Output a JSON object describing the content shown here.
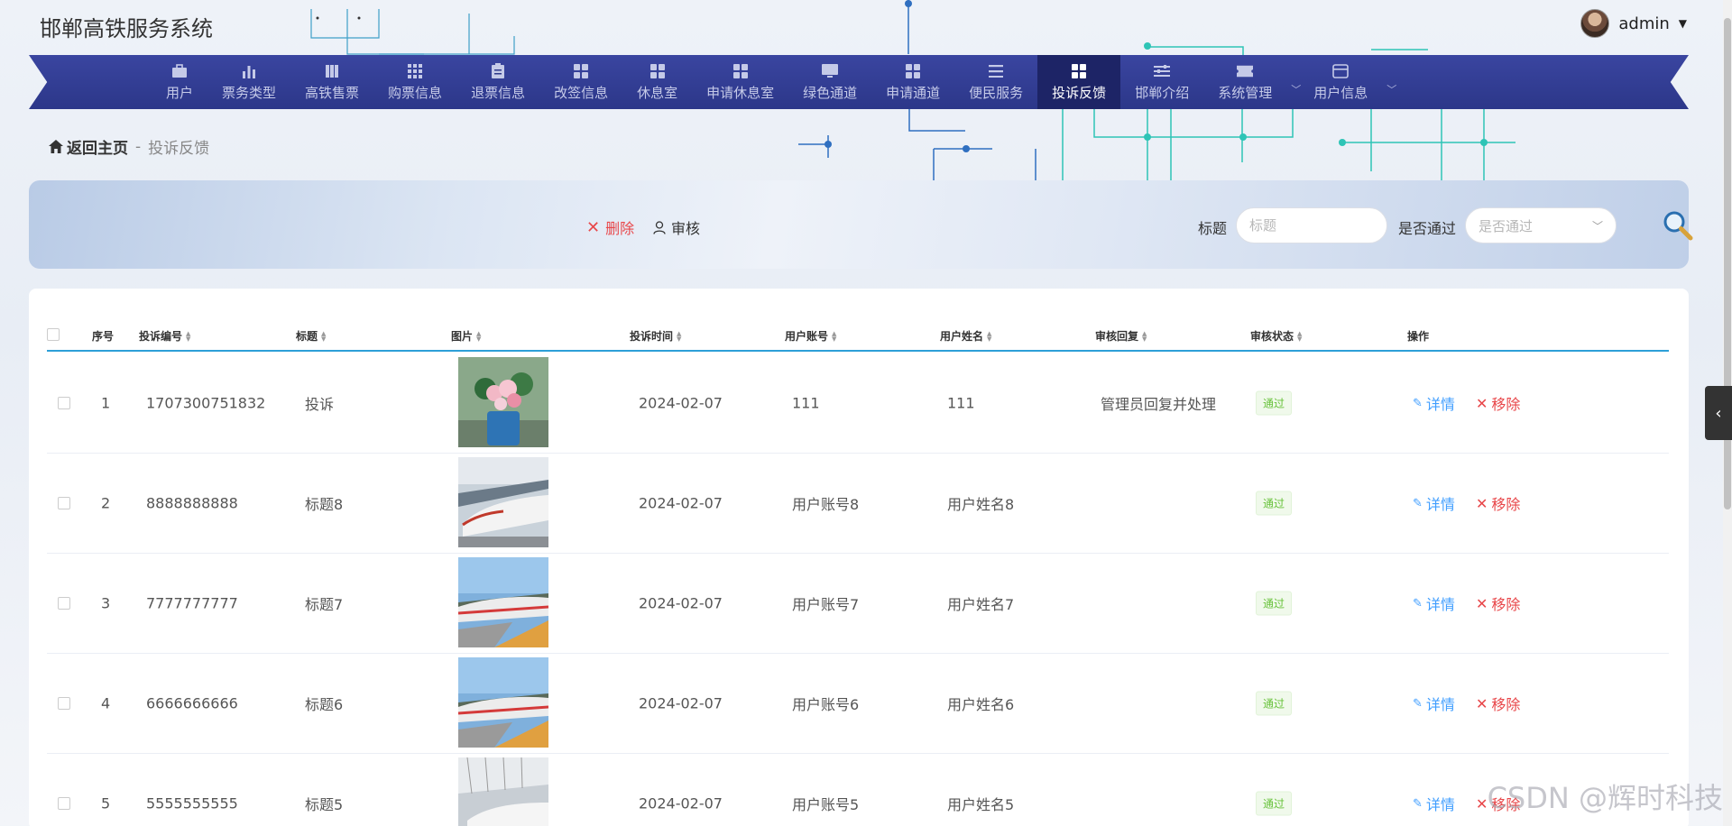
{
  "app": {
    "title": "邯郸高铁服务系统"
  },
  "user": {
    "name": "admin"
  },
  "nav": {
    "items": [
      {
        "label": "用户",
        "icon": "briefcase-icon"
      },
      {
        "label": "票务类型",
        "icon": "bar-chart-icon"
      },
      {
        "label": "高铁售票",
        "icon": "columns-icon"
      },
      {
        "label": "购票信息",
        "icon": "grid9-icon"
      },
      {
        "label": "退票信息",
        "icon": "clipboard-icon"
      },
      {
        "label": "改签信息",
        "icon": "grid4-icon"
      },
      {
        "label": "休息室",
        "icon": "grid4-icon"
      },
      {
        "label": "申请休息室",
        "icon": "grid4-icon"
      },
      {
        "label": "绿色通道",
        "icon": "monitor-icon"
      },
      {
        "label": "申请通道",
        "icon": "grid4-icon"
      },
      {
        "label": "便民服务",
        "icon": "list-icon"
      },
      {
        "label": "投诉反馈",
        "icon": "grid4-icon",
        "active": true
      },
      {
        "label": "邯郸介绍",
        "icon": "sliders-icon"
      },
      {
        "label": "系统管理",
        "icon": "ticket-icon",
        "dropdown": true
      },
      {
        "label": "用户信息",
        "icon": "wallet-icon",
        "dropdown": true
      }
    ]
  },
  "breadcrumb": {
    "home": "返回主页",
    "separator": "-",
    "current": "投诉反馈"
  },
  "toolbar": {
    "delete_label": "删除",
    "audit_label": "审核"
  },
  "search": {
    "title_label": "标题",
    "title_placeholder": "标题",
    "pass_label": "是否通过",
    "pass_placeholder": "是否通过"
  },
  "table": {
    "columns": [
      "序号",
      "投诉编号",
      "标题",
      "图片",
      "投诉时间",
      "用户账号",
      "用户姓名",
      "审核回复",
      "审核状态",
      "操作"
    ],
    "rows": [
      {
        "index": "1",
        "code": "1707300751832",
        "title": "投诉",
        "image": "flowers",
        "time": "2024-02-07",
        "account": "111",
        "name": "111",
        "reply": "管理员回复并处理",
        "status": "通过"
      },
      {
        "index": "2",
        "code": "8888888888",
        "title": "标题8",
        "image": "train-station",
        "time": "2024-02-07",
        "account": "用户账号8",
        "name": "用户姓名8",
        "reply": "",
        "status": "通过"
      },
      {
        "index": "3",
        "code": "7777777777",
        "title": "标题7",
        "image": "train-platform",
        "time": "2024-02-07",
        "account": "用户账号7",
        "name": "用户姓名7",
        "reply": "",
        "status": "通过"
      },
      {
        "index": "4",
        "code": "6666666666",
        "title": "标题6",
        "image": "train-platform",
        "time": "2024-02-07",
        "account": "用户账号6",
        "name": "用户姓名6",
        "reply": "",
        "status": "通过"
      },
      {
        "index": "5",
        "code": "5555555555",
        "title": "标题5",
        "image": "train-hall",
        "time": "2024-02-07",
        "account": "用户账号5",
        "name": "用户姓名5",
        "reply": "",
        "status": "通过"
      }
    ],
    "detail_label": "详情",
    "remove_label": "移除"
  },
  "watermark": "CSDN @辉时科技",
  "colors": {
    "nav_bg": "#2c3789",
    "nav_active": "#1d2466",
    "accent_line": "#2d9fd8",
    "danger": "#e8474a",
    "link": "#409eff",
    "success": "#67c23a"
  }
}
